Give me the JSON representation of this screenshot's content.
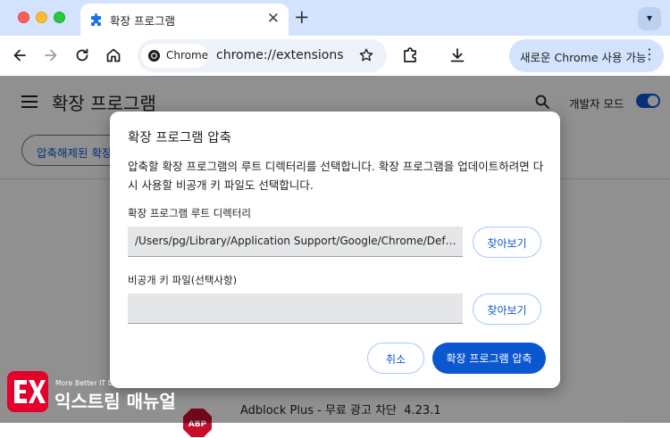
{
  "browser": {
    "tab": {
      "title": "확장 프로그램",
      "icon": "puzzle-icon"
    },
    "url_chip": "Chrome",
    "url": "chrome://extensions",
    "update_button": "새로운 Chrome 사용 가능"
  },
  "page": {
    "title": "확장 프로그램",
    "dev_mode_label": "개발자 모드",
    "dev_mode_on": true,
    "load_unpacked": "압축해제된 확장",
    "extension": {
      "name": "Adblock Plus - 무료 광고 차단",
      "version": "4.23.1"
    }
  },
  "dialog": {
    "title": "확장 프로그램 압축",
    "description": "압축할 확장 프로그램의 루트 디렉터리를 선택합니다. 확장 프로그램을 업데이트하려면 다시 사용할 비공개 키 파일도 선택합니다.",
    "root_label": "확장 프로그램 루트 디렉터리",
    "root_value": "/Users/pg/Library/Application Support/Google/Chrome/Default...",
    "browse_label": "찾아보기",
    "key_label": "비공개 키 파일(선택사항)",
    "key_value": "",
    "cancel_label": "취소",
    "pack_label": "확장 프로그램 압축"
  },
  "watermark": {
    "tagline": "More Better IT Life",
    "name": "익스트림 매뉴얼"
  },
  "colors": {
    "accent": "#0b57d0",
    "tabstrip": "#d3e3fd",
    "watermark": "#e4002b"
  }
}
